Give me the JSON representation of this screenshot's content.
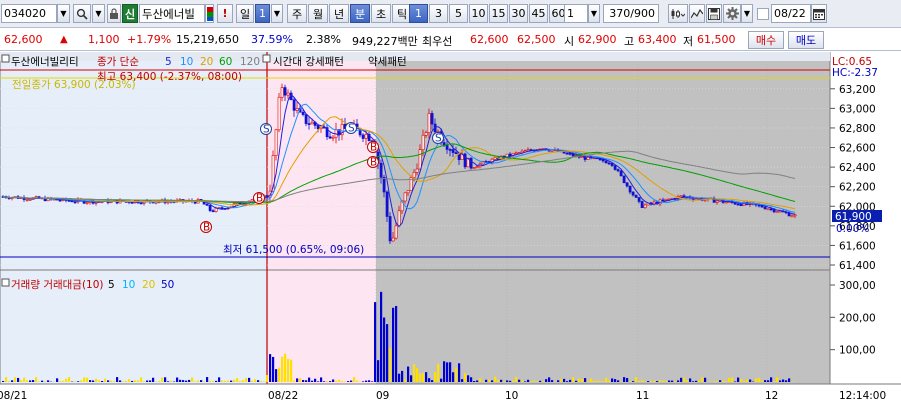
{
  "toolbar": {
    "code": "034020",
    "name_badge": "신",
    "name": "두산에너빌",
    "interval_day": "일",
    "interval_value": "1",
    "week": "주",
    "month": "월",
    "year": "년",
    "minute": "분",
    "second": "초",
    "tick": "틱",
    "presets": [
      "1",
      "3",
      "5",
      "10",
      "15",
      "30",
      "45",
      "60"
    ],
    "count_value": "1",
    "range_counter": "370/900",
    "date": "08/22"
  },
  "quote": {
    "price": "62,600",
    "change_arrow": "▲",
    "change": "1,100",
    "change_pct": "+1.79%",
    "volume": "15,219,650",
    "turnover_pct": "37.59%",
    "pct2": "2.38%",
    "amount": "949,227백만",
    "best_label": "최우선",
    "best_ask": "62,600",
    "best_bid": "62,500",
    "open_label": "시",
    "open": "62,900",
    "high_label": "고",
    "high": "63,400",
    "low_label": "저",
    "low": "61,500",
    "buy_button": "매수",
    "sell_button": "매도"
  },
  "chart": {
    "legend_name": "두산에너빌리티",
    "legend_ma": "종가 단순",
    "ma_periods": [
      "5",
      "10",
      "20",
      "60",
      "120"
    ],
    "ma_colors": [
      "#2020e0",
      "#2090ff",
      "#e0a000",
      "#00a000",
      "#808080"
    ],
    "legend_pattern1": "시간대 강세패턴",
    "legend_pattern2": "약세패턴",
    "prev_close_label": "전일종가 63,900 (2.03%)",
    "high_note": "최고 63,400 (-2.37%, 08:00)",
    "low_note": "최저 61,500 (0.65%, 09:06)",
    "lc_label": "LC:0.65",
    "hc_label": "HC:-2.37",
    "current_price": "61,900",
    "current_pct": "0.00%",
    "price_ticks": [
      "63,200",
      "63,000",
      "62,800",
      "62,600",
      "62,400",
      "62,200",
      "62,000",
      "61,800",
      "61,600",
      "61,400"
    ],
    "volume_legend": "거래량 거래대금(10) ",
    "volume_ma_periods": [
      "5",
      "10",
      "20",
      "50"
    ],
    "volume_ticks": [
      "300,00",
      "200,00",
      "100,00"
    ],
    "time_labels": [
      "08/21",
      "08/22",
      "09",
      "10",
      "11",
      "12"
    ],
    "time_now": "12:14:00",
    "colors": {
      "up": "#e00000",
      "down": "#1010d0",
      "session_pre": "#e6eefa",
      "session_pink": "#fde6f2",
      "session_grey": "#c1c1c1",
      "volume_up": "#ffe000",
      "volume_down": "#0000d0"
    }
  },
  "chart_data": {
    "type": "candlestick",
    "title": "",
    "ylim": [
      61400,
      63300
    ],
    "y_ticks": [
      61400,
      61600,
      61800,
      62000,
      62200,
      62400,
      62600,
      62800,
      63000,
      63200
    ],
    "reference_lines": {
      "high": 63400,
      "low": 61500
    },
    "x_sessions": [
      "08/21",
      "08/22",
      "09",
      "10",
      "11",
      "12"
    ],
    "price_path": [
      {
        "t": "08/21",
        "price": 62100
      },
      {
        "t": "08/22 08:00",
        "price": 62100
      },
      {
        "t": "08/22 08:00",
        "price": 63400
      },
      {
        "t": "08/22 09:00",
        "price": 62750
      },
      {
        "t": "08/22 09:06",
        "price": 61500
      },
      {
        "t": "08/22 09:20",
        "price": 62800
      },
      {
        "t": "08/22 10:00",
        "price": 62550
      },
      {
        "t": "08/22 11:00",
        "price": 62100
      },
      {
        "t": "08/22 12:14",
        "price": 61900
      }
    ],
    "volume_ylim": [
      0,
      320
    ],
    "volume_peak": 300
  }
}
